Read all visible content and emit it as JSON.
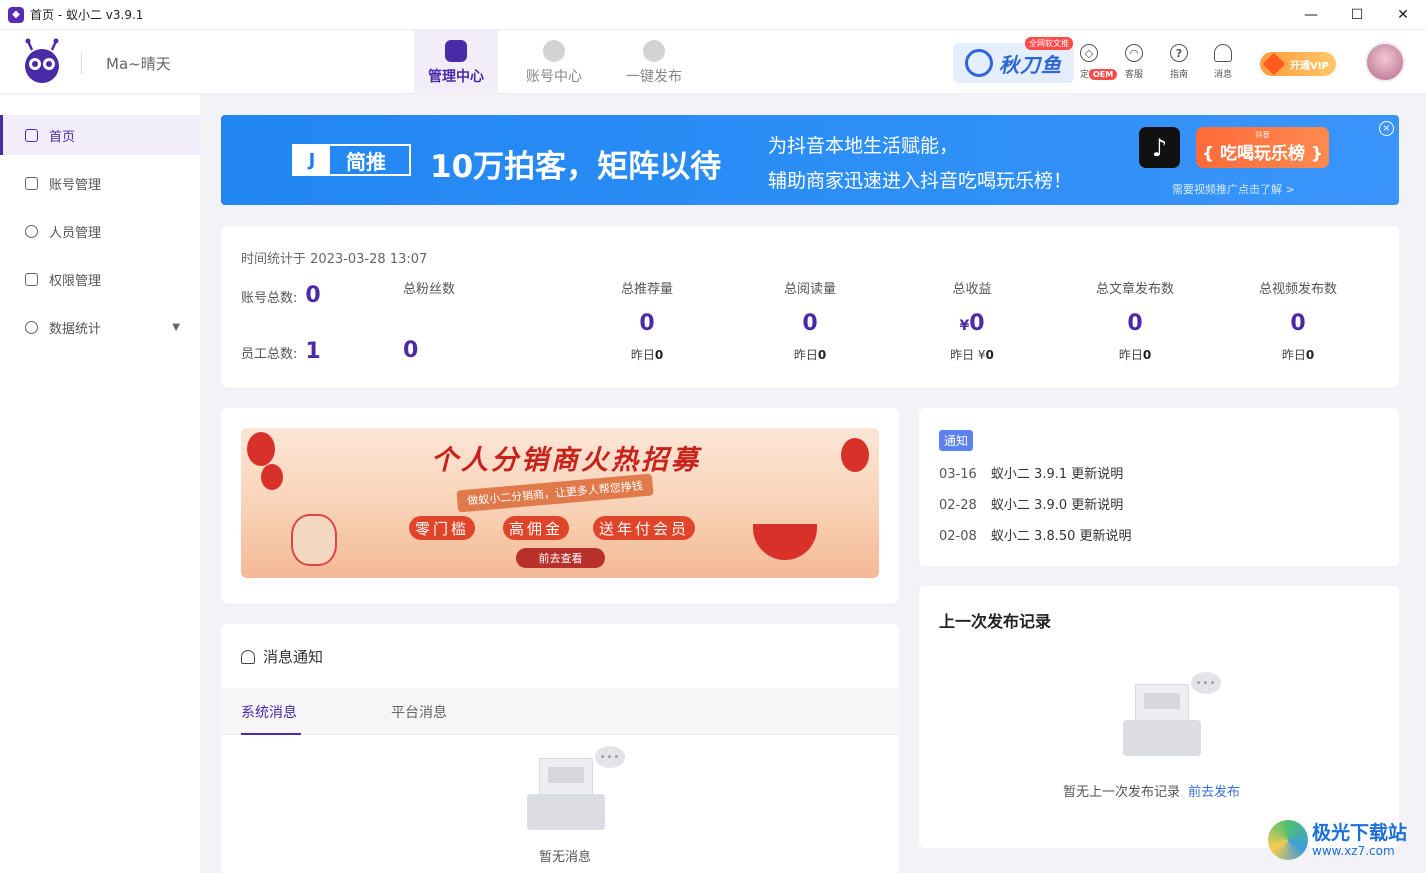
{
  "window": {
    "title": "首页 - 蚁小二 v3.9.1",
    "controls": [
      "—",
      "☐",
      "✕"
    ]
  },
  "header": {
    "user_name": "Ma~晴天",
    "nav": [
      {
        "label": "管理中心",
        "active": true
      },
      {
        "label": "账号中心",
        "active": false
      },
      {
        "label": "一键发布",
        "active": false
      }
    ],
    "promo_logo": "秋刀鱼",
    "promo_badge": "全网软文推",
    "oem_badge": "OEM",
    "tools": [
      {
        "label": "定制",
        "icon": "customize-icon"
      },
      {
        "label": "客服",
        "icon": "headset-icon"
      },
      {
        "label": "指南",
        "icon": "help-icon"
      },
      {
        "label": "消息",
        "icon": "bell-icon"
      }
    ],
    "vip_label": "开通VIP"
  },
  "sidebar": {
    "items": [
      {
        "label": "首页",
        "icon": "home-icon",
        "active": true
      },
      {
        "label": "账号管理",
        "icon": "grid-icon"
      },
      {
        "label": "人员管理",
        "icon": "person-icon"
      },
      {
        "label": "权限管理",
        "icon": "lock-icon"
      },
      {
        "label": "数据统计",
        "icon": "chart-icon",
        "expandable": true
      }
    ]
  },
  "banner": {
    "brand_mark": "J",
    "brand": "简推",
    "headline": "10万拍客，矩阵以待",
    "sub1": "为抖音本地生活赋能，",
    "sub2": "辅助商家迅速进入抖音吃喝玩乐榜！",
    "tiktok_glyph": "♪",
    "badge_small": "抖音",
    "badge_big": "{ 吃喝玩乐榜 }",
    "link": "需要视频推广点击了解 >",
    "close": "×"
  },
  "stats": {
    "time_label": "时间统计于 2023-03-28 13:07",
    "account_total_label": "账号总数:",
    "account_total": "0",
    "employee_total_label": "员工总数:",
    "employee_total": "1",
    "fans_label": "总粉丝数",
    "fans_value": "0",
    "columns": [
      {
        "label": "总推荐量",
        "value": "0",
        "yesterday_label": "昨日",
        "yesterday": "0"
      },
      {
        "label": "总阅读量",
        "value": "0",
        "yesterday_label": "昨日",
        "yesterday": "0"
      },
      {
        "label": "总收益",
        "currency": "¥",
        "value": "0",
        "yesterday_label": "昨日 ¥",
        "yesterday": "0"
      },
      {
        "label": "总文章发布数",
        "value": "0",
        "yesterday_label": "昨日",
        "yesterday": "0"
      },
      {
        "label": "总视频发布数",
        "value": "0",
        "yesterday_label": "昨日",
        "yesterday": "0"
      }
    ]
  },
  "promo": {
    "title": "个人分销商火热招募",
    "subtitle": "做蚁小二分销商，让更多人帮您挣钱",
    "pills": [
      "零门槛",
      "高佣金",
      "送年付会员"
    ],
    "button": "前去查看"
  },
  "notice": {
    "tag": "通知",
    "items": [
      {
        "date": "03-16",
        "text": "蚁小二 3.9.1 更新说明"
      },
      {
        "date": "02-28",
        "text": "蚁小二 3.9.0 更新说明"
      },
      {
        "date": "02-08",
        "text": "蚁小二 3.8.50 更新说明"
      }
    ]
  },
  "messages": {
    "title": "消息通知",
    "tabs": [
      "系统消息",
      "平台消息"
    ],
    "empty": "暂无消息",
    "bubble": "•••"
  },
  "publish": {
    "title": "上一次发布记录",
    "empty": "暂无上一次发布记录",
    "link": "前去发布"
  },
  "watermark": {
    "name": "极光下载站",
    "url": "www.xz7.com"
  },
  "colors": {
    "accent": "#4b2aa8",
    "banner_blue": "#2286f2",
    "link": "#3a6fd8"
  }
}
